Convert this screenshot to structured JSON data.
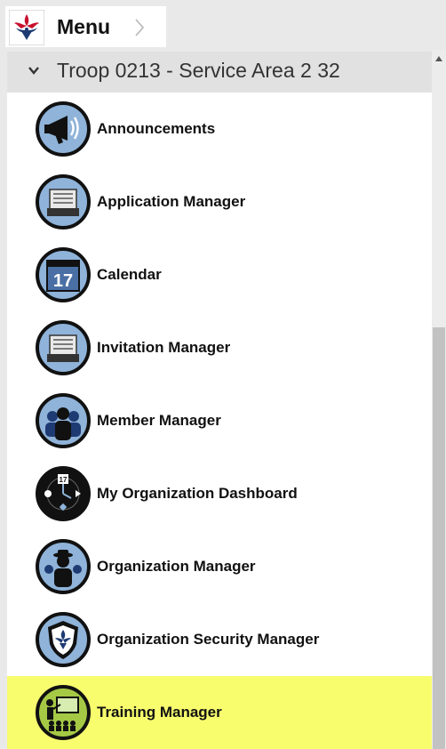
{
  "menu": {
    "label": "Menu"
  },
  "group": {
    "title": "Troop 0213 - Service Area 2 32",
    "expanded": true
  },
  "items": [
    {
      "label": "Announcements",
      "icon": "megaphone-icon"
    },
    {
      "label": "Application Manager",
      "icon": "inbox-tray-icon"
    },
    {
      "label": "Calendar",
      "icon": "calendar-icon",
      "icon_text": "17"
    },
    {
      "label": "Invitation Manager",
      "icon": "inbox-tray-icon"
    },
    {
      "label": "Member Manager",
      "icon": "members-icon"
    },
    {
      "label": "My Organization Dashboard",
      "icon": "dashboard-icon",
      "icon_text": "17"
    },
    {
      "label": "Organization Manager",
      "icon": "organization-icon"
    },
    {
      "label": "Organization Security Manager",
      "icon": "shield-icon"
    },
    {
      "label": "Training Manager",
      "icon": "training-icon",
      "selected": true
    }
  ],
  "colors": {
    "icon_fill": "#8fb3d9",
    "icon_border": "#111111",
    "selected_bg": "#f8fd6e",
    "training_icon_fill": "#a5c945"
  }
}
